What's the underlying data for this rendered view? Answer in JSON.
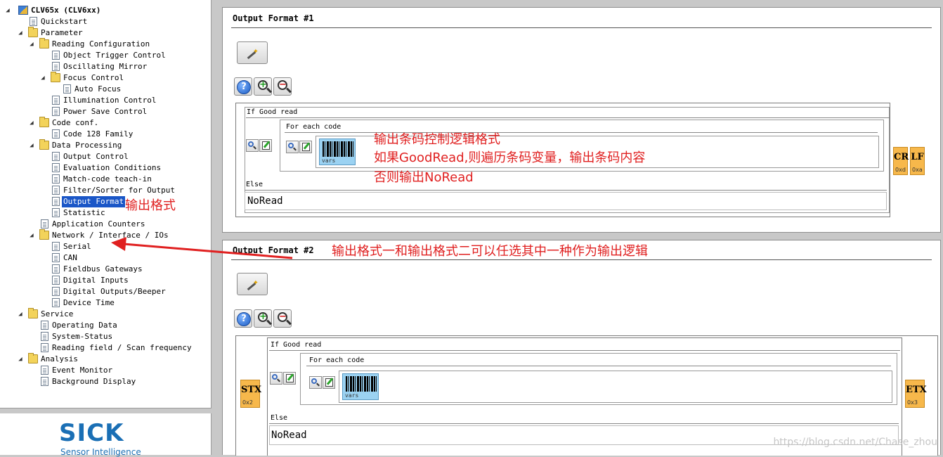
{
  "tree": {
    "nodes": [
      {
        "label": "CLV65x (CLV6xx)",
        "level": 0,
        "icon": "device",
        "expanded": true,
        "bold": true
      },
      {
        "label": "Quickstart",
        "level": 1,
        "icon": "page"
      },
      {
        "label": "Parameter",
        "level": 1,
        "icon": "folder",
        "expanded": true
      },
      {
        "label": "Reading Configuration",
        "level": 2,
        "icon": "folder",
        "expanded": true
      },
      {
        "label": "Object Trigger Control",
        "level": 3,
        "icon": "page"
      },
      {
        "label": "Oscillating Mirror",
        "level": 3,
        "icon": "page"
      },
      {
        "label": "Focus Control",
        "level": 3,
        "icon": "folder",
        "expanded": true
      },
      {
        "label": "Auto Focus",
        "level": 4,
        "icon": "page"
      },
      {
        "label": "Illumination Control",
        "level": 3,
        "icon": "page"
      },
      {
        "label": "Power Save Control",
        "level": 3,
        "icon": "page"
      },
      {
        "label": "Code conf.",
        "level": 2,
        "icon": "folder",
        "expanded": true
      },
      {
        "label": "Code 128 Family",
        "level": 3,
        "icon": "page"
      },
      {
        "label": "Data Processing",
        "level": 2,
        "icon": "folder",
        "expanded": true
      },
      {
        "label": "Output Control",
        "level": 3,
        "icon": "page"
      },
      {
        "label": "Evaluation Conditions",
        "level": 3,
        "icon": "page"
      },
      {
        "label": "Match-code teach-in",
        "level": 3,
        "icon": "page"
      },
      {
        "label": "Filter/Sorter for Output",
        "level": 3,
        "icon": "page"
      },
      {
        "label": "Output Format",
        "level": 3,
        "icon": "page",
        "selected": true
      },
      {
        "label": "Statistic",
        "level": 3,
        "icon": "page"
      },
      {
        "label": "Application Counters",
        "level": 2,
        "icon": "page"
      },
      {
        "label": "Network / Interface / IOs",
        "level": 2,
        "icon": "folder",
        "expanded": true
      },
      {
        "label": "Serial",
        "level": 3,
        "icon": "page"
      },
      {
        "label": "CAN",
        "level": 3,
        "icon": "page"
      },
      {
        "label": "Fieldbus Gateways",
        "level": 3,
        "icon": "page"
      },
      {
        "label": "Digital Inputs",
        "level": 3,
        "icon": "page"
      },
      {
        "label": "Digital Outputs/Beeper",
        "level": 3,
        "icon": "page"
      },
      {
        "label": "Device Time",
        "level": 3,
        "icon": "page"
      },
      {
        "label": "Service",
        "level": 1,
        "icon": "folder",
        "expanded": true
      },
      {
        "label": "Operating Data",
        "level": 2,
        "icon": "page"
      },
      {
        "label": "System-Status",
        "level": 2,
        "icon": "page"
      },
      {
        "label": "Reading field / Scan frequency",
        "level": 2,
        "icon": "page"
      },
      {
        "label": "Analysis",
        "level": 1,
        "icon": "folder",
        "expanded": true
      },
      {
        "label": "Event Monitor",
        "level": 2,
        "icon": "page"
      },
      {
        "label": "Background Display",
        "level": 2,
        "icon": "page"
      }
    ]
  },
  "logo": {
    "text": "SICK",
    "subtitle": "Sensor Intelligence"
  },
  "formats": [
    {
      "title": "Output Format #1",
      "if_label": "If Good read",
      "for_each_label": "For each code",
      "barcode_label": "vars",
      "else_label": "Else",
      "else_value": "NoRead",
      "prefix": [],
      "suffix": [
        {
          "text": "CR",
          "code": "0xd"
        },
        {
          "text": "LF",
          "code": "0xa"
        }
      ]
    },
    {
      "title": "Output Format #2",
      "if_label": "If Good read",
      "for_each_label": "For each code",
      "barcode_label": "vars",
      "else_label": "Else",
      "else_value": "NoRead",
      "prefix": [
        {
          "text": "STX",
          "code": "0x2"
        }
      ],
      "suffix": [
        {
          "text": "ETX",
          "code": "0x3"
        }
      ]
    }
  ],
  "annotations": {
    "tree_note": "输出格式",
    "format1_lines": [
      "输出条码控制逻辑格式",
      "如果GoodRead,则遍历条码变量，输出条码内容",
      "否则输出NoRead"
    ],
    "format2_note": "输出格式一和输出格式二可以任选其中一种作为输出逻辑",
    "color": "#e02020"
  },
  "watermark": "https://blog.csdn.net/Chase_zhou",
  "icons": {
    "wizard": "magic-wand-icon",
    "help": "help-icon",
    "zoom_in": "zoom-in-icon",
    "zoom_out": "zoom-out-icon",
    "edit": "edit-icon",
    "barcode": "barcode-icon"
  }
}
